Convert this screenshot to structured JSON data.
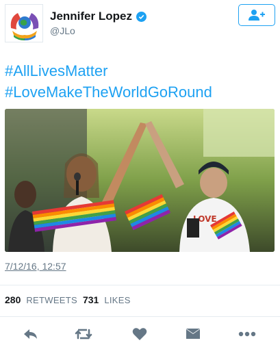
{
  "tweet": {
    "author_name": "Jennifer Lopez",
    "handle": "@JLo",
    "hashtag_1": "#AllLivesMatter",
    "hashtag_2": "#LoveMakeTheWorldGoRound",
    "timestamp": "7/12/16, 12:57",
    "retweet_count": "280",
    "retweet_label": "RETWEETS",
    "like_count": "731",
    "like_label": "LIKES"
  },
  "icons": {
    "verified": "verified-badge-icon",
    "follow": "add-user-icon",
    "reply": "reply-icon",
    "retweet": "retweet-icon",
    "like": "heart-icon",
    "dm": "envelope-icon",
    "more": "more-dots-icon"
  },
  "colors": {
    "accent": "#1da1f2",
    "icon_gray": "#657786",
    "text": "#14171a"
  }
}
